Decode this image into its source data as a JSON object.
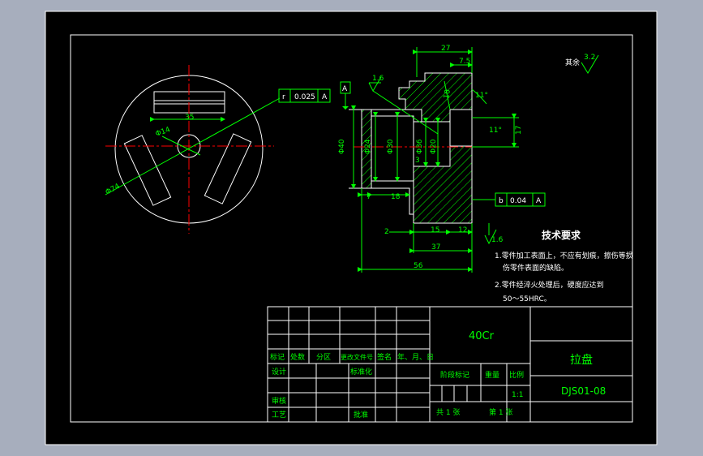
{
  "colors": {
    "background": "#000000",
    "frame": "#ffffff",
    "dimension": "#00ff00",
    "centerline": "#ff0000",
    "text": "#ffffff",
    "title_block_text": "#00ff00",
    "hatch": "#00ff00"
  },
  "surface_finish_other": {
    "label": "其余",
    "value": "3.2"
  },
  "front_view": {
    "diameter_14": "Φ14",
    "diameter_74": "Φ74",
    "width_35": "35",
    "geometric_tolerance": {
      "symbol": "r",
      "value": "0.025",
      "datum": "A"
    }
  },
  "section_view": {
    "datum_a": "A",
    "dims": {
      "d27": "27",
      "d7_5": "7.5",
      "d10": "10",
      "ang11_top": "11°",
      "ang11_right": "11°",
      "d17": "17",
      "phi40": "Φ40",
      "phi24": "Φ24",
      "phi30": "Φ30",
      "phi36": "Φ36",
      "phi20": "Φ20",
      "d3": "3",
      "d7": "7",
      "d18": "18",
      "d2": "2",
      "d15": "15",
      "d12": "12",
      "d37": "37",
      "d56": "56"
    },
    "roughness_left": "1.6",
    "roughness_bottom": "1.6",
    "tolerance_box": {
      "symbol": "b",
      "value": "0.04",
      "datum": "A"
    }
  },
  "tech_requirements": {
    "title": "技术要求",
    "items": [
      "1.零件加工表面上，不应有划痕，擦伤等损",
      "伤零件表面的缺陷。",
      "2.零件经淬火处理后，硬度应达到",
      "50～55HRC。"
    ]
  },
  "title_block": {
    "material": "40Cr",
    "part_name": "拉盘",
    "drawing_number": "DJS01-08",
    "headers": [
      "标记",
      "处数",
      "分区",
      "更改文件号",
      "签名",
      "年、月、日"
    ],
    "design": "设计",
    "standardization": "标准化",
    "review": "审核",
    "process": "工艺",
    "approve": "批准",
    "stage_mark": "阶段标记",
    "weight": "重量",
    "scale_label": "比例",
    "scale": "1:1",
    "sheets_total": "共 1 张",
    "sheet_no": "第 1 张"
  }
}
